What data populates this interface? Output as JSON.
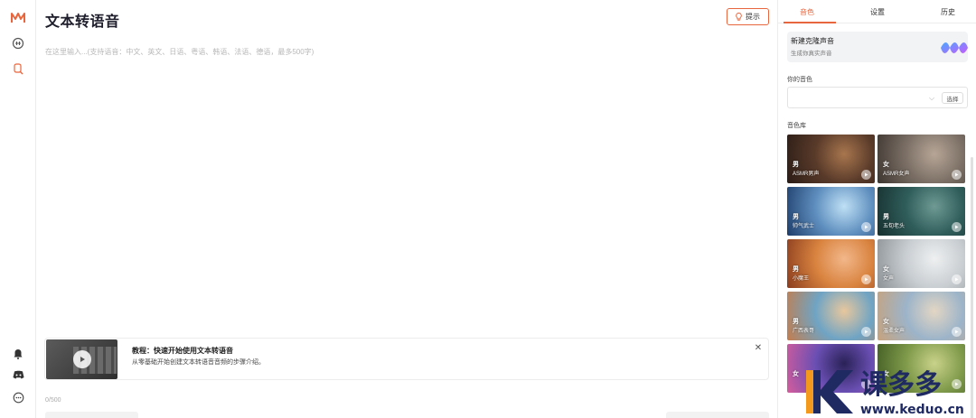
{
  "page": {
    "title": "文本转语音"
  },
  "rail": {
    "icons": [
      "logo-icon",
      "speech-icon",
      "voice-search-icon",
      "bell-icon",
      "discord-icon",
      "chat-icon"
    ]
  },
  "header": {
    "hint_label": "提示"
  },
  "editor": {
    "placeholder": "在这里输入...(支持语音：中文、英文、日语、粤语、韩语、法语、德语，最多500字)"
  },
  "tutorial": {
    "title": "教程：快速开始使用文本转语音",
    "desc": "从零基础开始创建文本转语音音频的步骤介绍。"
  },
  "footer": {
    "char_count": "0/500"
  },
  "panel": {
    "tabs": [
      {
        "label": "音色",
        "active": true
      },
      {
        "label": "设置",
        "active": false
      },
      {
        "label": "历史",
        "active": false
      }
    ],
    "clone": {
      "title": "新建克隆声音",
      "subtitle": "生成你真实声音"
    },
    "my_voice_label": "你的音色",
    "select_label": "选择",
    "library_label": "音色库",
    "voices": [
      {
        "gender": "男",
        "name": "ASMR男声",
        "colors": [
          "#5a3b2a",
          "#2b1c16",
          "#a8764e"
        ]
      },
      {
        "gender": "女",
        "name": "ASMR女声",
        "colors": [
          "#7c7066",
          "#3d3530",
          "#b7a697"
        ]
      },
      {
        "gender": "男",
        "name": "帅气武士",
        "colors": [
          "#5f8fbf",
          "#1d3d6b",
          "#bfe0f5"
        ]
      },
      {
        "gender": "男",
        "name": "五旬老头",
        "colors": [
          "#2f5d5a",
          "#16302f",
          "#6f9a94"
        ]
      },
      {
        "gender": "男",
        "name": "小魔王",
        "colors": [
          "#d9833f",
          "#8a3c1e",
          "#f2b78a"
        ]
      },
      {
        "gender": "女",
        "name": "女声",
        "colors": [
          "#c9ced2",
          "#8c9296",
          "#eef0f1"
        ]
      },
      {
        "gender": "男",
        "name": "广西表哥",
        "colors": [
          "#6fa4c4",
          "#c47d4d",
          "#e8c79d"
        ]
      },
      {
        "gender": "女",
        "name": "温柔女声",
        "colors": [
          "#9cb4c9",
          "#c7a37d",
          "#e3d6c4"
        ]
      },
      {
        "gender": "女",
        "name": "",
        "colors": [
          "#6a4fb3",
          "#d45d9c",
          "#2a2257"
        ]
      },
      {
        "gender": "女",
        "name": "",
        "colors": [
          "#7f9a4a",
          "#3f5a22",
          "#c9d28a"
        ]
      }
    ]
  },
  "watermark": {
    "text": "课多多",
    "domain": "www.keduo.cn"
  }
}
